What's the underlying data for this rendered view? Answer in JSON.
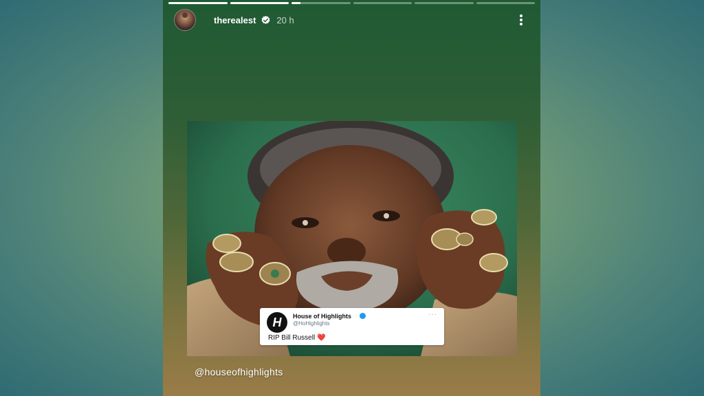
{
  "story": {
    "segments": [
      1,
      1,
      0.15,
      0,
      0,
      0
    ]
  },
  "header": {
    "username": "therealest",
    "verified": true,
    "verified_icon": "verified-check-icon",
    "time_ago": "20 h",
    "more_icon": "more-vertical-icon"
  },
  "post": {
    "tweet": {
      "logo_letter": "H",
      "display_name": "House of Highlights",
      "handle": "@HoHighlights",
      "more": "···",
      "text": "RIP Bill Russell",
      "emoji": "❤️"
    },
    "mention": "@houseofhighlights"
  },
  "colors": {
    "story_top": "#1f5a33",
    "story_bottom": "#9a7c48",
    "verified_blue": "#1d9bf0",
    "heart_red": "#e0245e"
  }
}
